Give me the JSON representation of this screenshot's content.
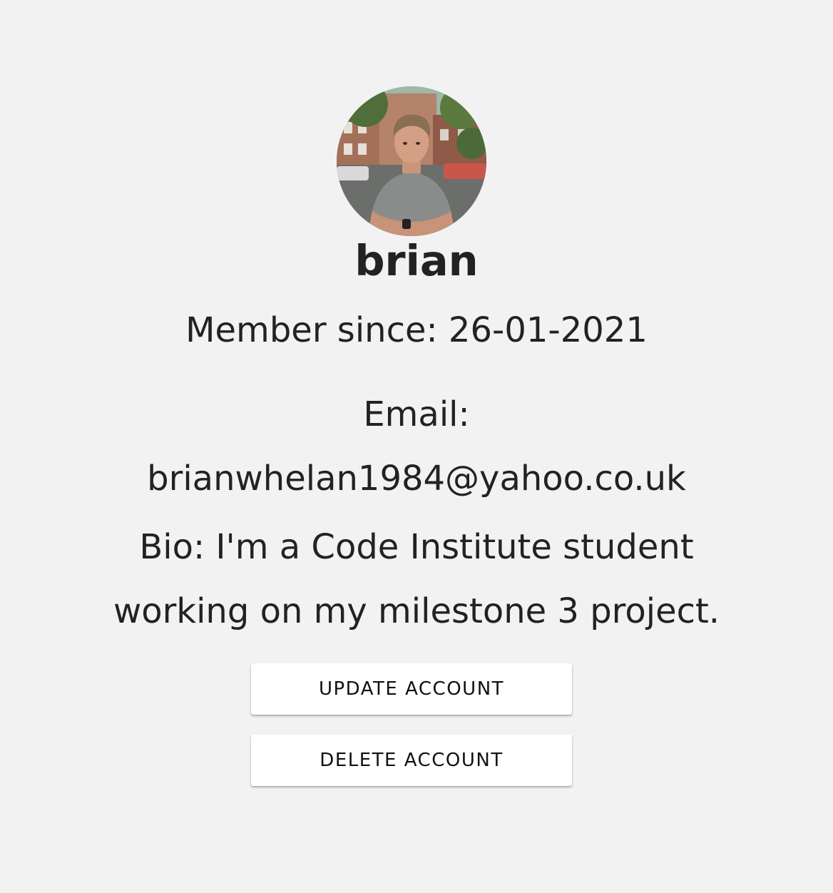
{
  "profile": {
    "avatar_alt": "profile photo of brian",
    "username": "brian",
    "member_since": "Member since: 26-01-2021",
    "email_label": "Email:",
    "email_value": "brianwhelan1984@yahoo.co.uk",
    "bio": "Bio: I'm a Code Institute student working on my milestone 3 project."
  },
  "actions": {
    "update_label": "UPDATE ACCOUNT",
    "delete_label": "DELETE ACCOUNT"
  },
  "colors": {
    "background": "#f2f2f2",
    "text": "#222222",
    "button_bg": "#ffffff"
  }
}
